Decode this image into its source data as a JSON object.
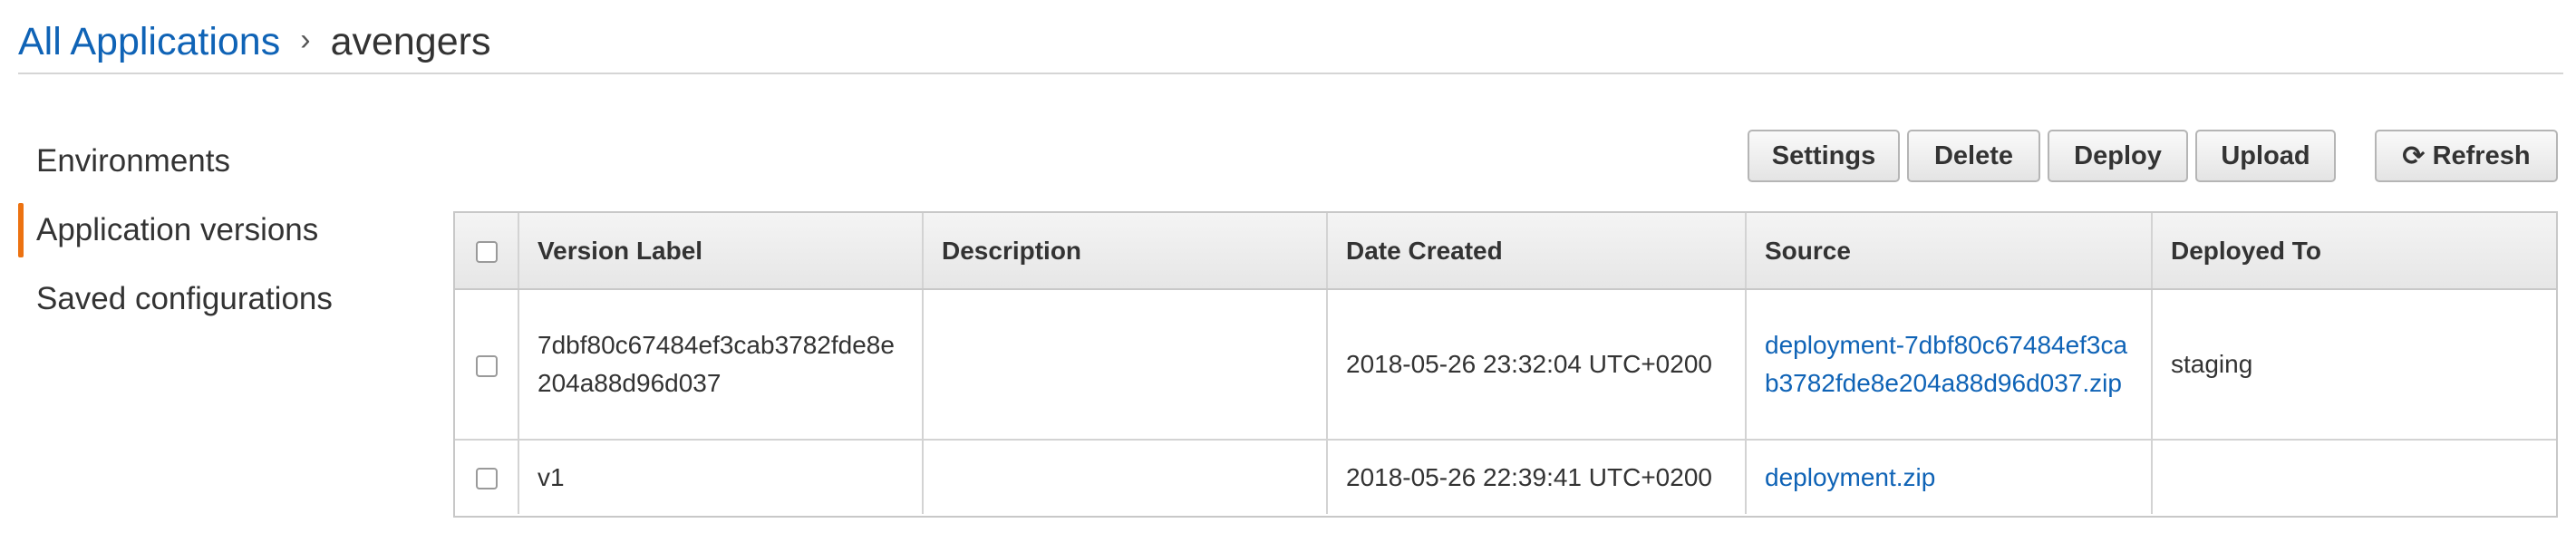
{
  "breadcrumb": {
    "root": "All Applications",
    "separator": "›",
    "current": "avengers"
  },
  "sidebar": {
    "items": [
      {
        "label": "Environments",
        "active": false
      },
      {
        "label": "Application versions",
        "active": true
      },
      {
        "label": "Saved configurations",
        "active": false
      }
    ]
  },
  "toolbar": {
    "settings_label": "Settings",
    "delete_label": "Delete",
    "deploy_label": "Deploy",
    "upload_label": "Upload",
    "refresh_label": "Refresh",
    "refresh_icon": "refresh-icon"
  },
  "table": {
    "columns": [
      "Version Label",
      "Description",
      "Date Created",
      "Source",
      "Deployed To"
    ],
    "rows": [
      {
        "version_label": "7dbf80c67484ef3cab3782fde8e204a88d96d037",
        "description": "",
        "date_created": "2018-05-26 23:32:04 UTC+0200",
        "source": "deployment-7dbf80c67484ef3cab3782fde8e204a88d96d037.zip",
        "deployed_to": "staging"
      },
      {
        "version_label": "v1",
        "description": "",
        "date_created": "2018-05-26 22:39:41 UTC+0200",
        "source": "deployment.zip",
        "deployed_to": ""
      }
    ]
  },
  "colors": {
    "link": "#0f63b6",
    "active_accent": "#ec7211"
  }
}
